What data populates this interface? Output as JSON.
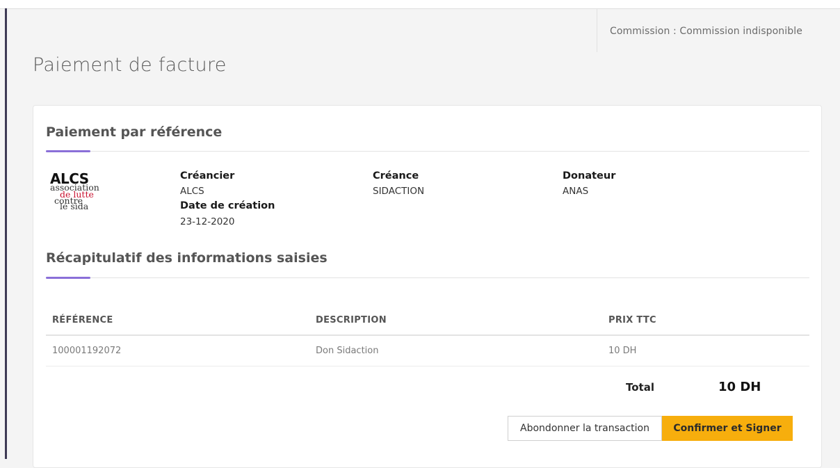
{
  "header": {
    "commission_text": "Commission : Commission indisponible"
  },
  "page": {
    "title": "Paiement de facture"
  },
  "reference_section": {
    "title": "Paiement par référence",
    "logo": {
      "name": "ALCS",
      "line1": "association",
      "line2": "de lutte",
      "line3": "contre",
      "line4": "le sida"
    },
    "creancier_label": "Créancier",
    "creancier_value": "ALCS",
    "date_label": "Date de création",
    "date_value": "23-12-2020",
    "creance_label": "Créance",
    "creance_value": "SIDACTION",
    "donateur_label": "Donateur",
    "donateur_value": "ANAS"
  },
  "summary_section": {
    "title": "Récapitulatif des informations saisies",
    "columns": [
      "RÉFÉRENCE",
      "DESCRIPTION",
      "PRIX TTC"
    ],
    "rows": [
      [
        "100001192072",
        "Don Sidaction",
        "10 DH"
      ]
    ],
    "total_label": "Total",
    "total_value": "10 DH"
  },
  "actions": {
    "cancel_label": "Abondonner la transaction",
    "confirm_label": "Confirmer et Signer"
  },
  "colors": {
    "accent": "#8a6fd8",
    "confirm_button": "#f7ae0d",
    "logo_red": "#c8102e"
  }
}
